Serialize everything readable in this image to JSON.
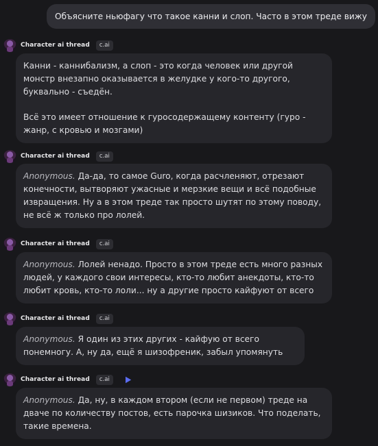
{
  "user_message": "Объясните ньюфагу что такое канни и слоп. Часто в этом треде вижу",
  "character": {
    "name": "Character ai thread",
    "badge": "c.ai"
  },
  "messages": [
    {
      "anon": "",
      "paragraphs": [
        "Канни - каннибализм, а слоп - это когда человек или другой монстр внезапно оказывается в желудке у кого-то другого, буквально - съедён.",
        "Всё это имеет отношение к гуросодержащему контенту (гуро - жанр, с кровью и мозгами)"
      ]
    },
    {
      "anon": "Anonymous.",
      "paragraphs": [
        "Да-да, то самое Guro, когда расчленяют, отрезают конечности, вытворяют ужасные и мерзкие вещи и всё подобные извращения. Ну а в этом треде так просто шутят по этому поводу, не всё ж только про лолей."
      ]
    },
    {
      "anon": "Anonymous.",
      "paragraphs": [
        "Лолей ненадо. Просто в этом треде есть много разных людей, у каждого свои интересы, кто-то любит анекдоты, кто-то любит кровь, кто-то лоли... ну а другие просто кайфуют от всего"
      ]
    },
    {
      "anon": "Anonymous.",
      "paragraphs": [
        "Я один из этих других - кайфую от всего понемногу. А, ну да, ещё я шизофреник, забыл упомянуть"
      ]
    },
    {
      "anon": "Anonymous.",
      "paragraphs": [
        "Да, ну, в каждом втором (если не первом) треде на дваче по количеству постов, есть парочка шизиков. Что поделать, такие времена."
      ]
    }
  ],
  "colors": {
    "background": "#18181b",
    "bubble": "#26262b",
    "user_bubble": "#2f2f35",
    "accent": "#5b6cf0"
  },
  "icons": {
    "avatar": "character-avatar",
    "play": "play-icon"
  }
}
